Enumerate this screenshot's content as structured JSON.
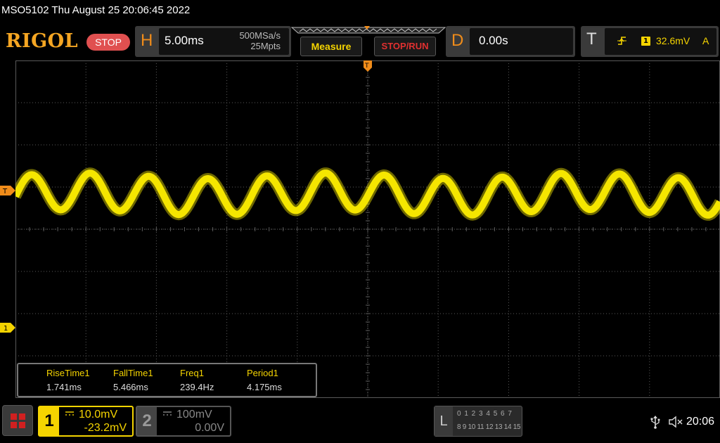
{
  "window": {
    "title": "MSO5102  Thu August 25 20:06:45 2022"
  },
  "toolbar": {
    "logo": "RIGOL",
    "run_status": "STOP",
    "horizontal": {
      "letter": "H",
      "timebase": "5.00ms",
      "sample_rate": "500MSa/s",
      "memory_depth": "25Mpts"
    },
    "measure_label": "Measure",
    "stop_run_label": "STOP/RUN",
    "delay": {
      "letter": "D",
      "value": "0.00s"
    },
    "trigger": {
      "letter": "T",
      "edge_icon": "rising-edge-icon",
      "source": "1",
      "level": "32.6mV",
      "mode": "A"
    }
  },
  "screen": {
    "trigger_marker_label": "T",
    "ch1_marker_label": "1",
    "trace_color": "#f5e600",
    "grid_divisions": {
      "horizontal": 10,
      "vertical": 8
    }
  },
  "measurements": [
    {
      "label": "RiseTime1",
      "value": "1.741ms"
    },
    {
      "label": "FallTime1",
      "value": "5.466ms"
    },
    {
      "label": "Freq1",
      "value": "239.4Hz"
    },
    {
      "label": "Period1",
      "value": "4.175ms"
    }
  ],
  "bottom": {
    "menu_icon": "menu-grid-icon",
    "ch1": {
      "number": "1",
      "coupling_icon": "dc-coupling-icon",
      "scale": "10.0mV",
      "offset": "-23.2mV",
      "color": "#f5d400"
    },
    "ch2": {
      "number": "2",
      "coupling_icon": "dc-coupling-icon",
      "scale": "100mV",
      "offset": "0.00V",
      "color": "#888888"
    },
    "logic": {
      "letter": "L",
      "row1": "0 1 2 3   4 5 6 7",
      "row2": "8  9 10 11  12 13 14 15"
    },
    "usb_icon": "usb-icon",
    "sound_icon": "speaker-muted-icon",
    "time": "20:06"
  }
}
